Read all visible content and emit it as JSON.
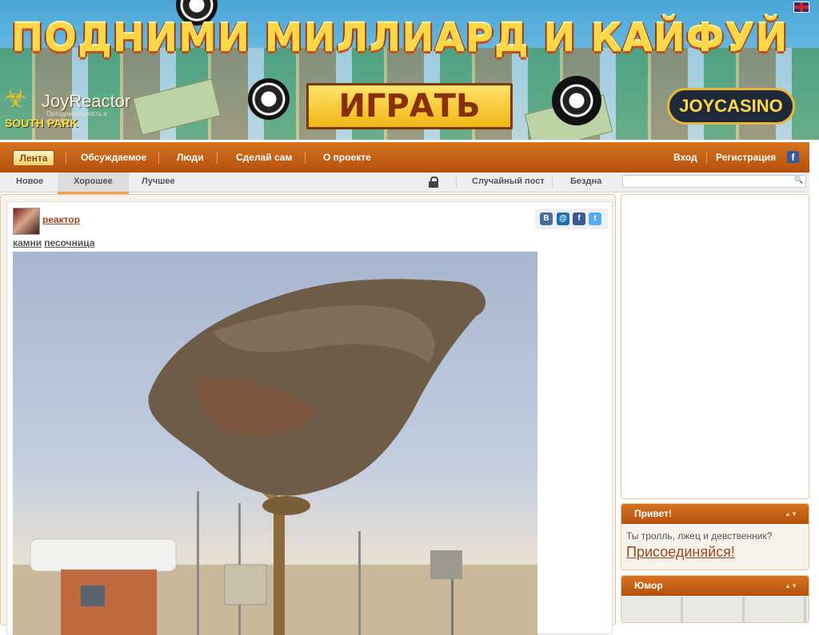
{
  "banner": {
    "headline": "ПОДНИМИ МИЛЛИАРД И КАЙФУЙ",
    "play_button": "ИГРАТЬ",
    "brand": "JOYCASINO"
  },
  "logo": {
    "name": "JoyReactor",
    "tagline": "Ортодоксальность и целибат",
    "overlay": "SOUTH PARK"
  },
  "main_nav": {
    "items": [
      "Лента",
      "Обсуждаемое",
      "Люди",
      "Сделай сам",
      "О проекте"
    ],
    "login": "Вход",
    "register": "Регистрация",
    "facebook": "f"
  },
  "sub_nav": {
    "items": [
      "Новое",
      "Хорошее",
      "Лучшее"
    ],
    "selected": "Хорошее",
    "random": "Случайный пост",
    "abyss": "Бездна",
    "search_placeholder": ""
  },
  "post": {
    "author": "реактор",
    "tags": [
      "камни",
      "песочница"
    ],
    "share": [
      {
        "label": "B",
        "color": "#4a6e9c"
      },
      {
        "label": "@",
        "color": "#1f6fb6"
      },
      {
        "label": "f",
        "color": "#3b5998"
      },
      {
        "label": "t",
        "color": "#55acee"
      }
    ],
    "image": "rock-hanging-on-rope-photo"
  },
  "sidebar": {
    "hello": {
      "title": "Привет!",
      "message": "Ты тролль, лжец и девственник?",
      "join": "Присоединяйся!"
    },
    "humor": {
      "title": "Юмор"
    },
    "toggle_glyph": "▲▼"
  },
  "colors": {
    "nav_orange": "#c9631a",
    "accent_link": "#a6421c",
    "panel_border": "#e7c79e"
  }
}
